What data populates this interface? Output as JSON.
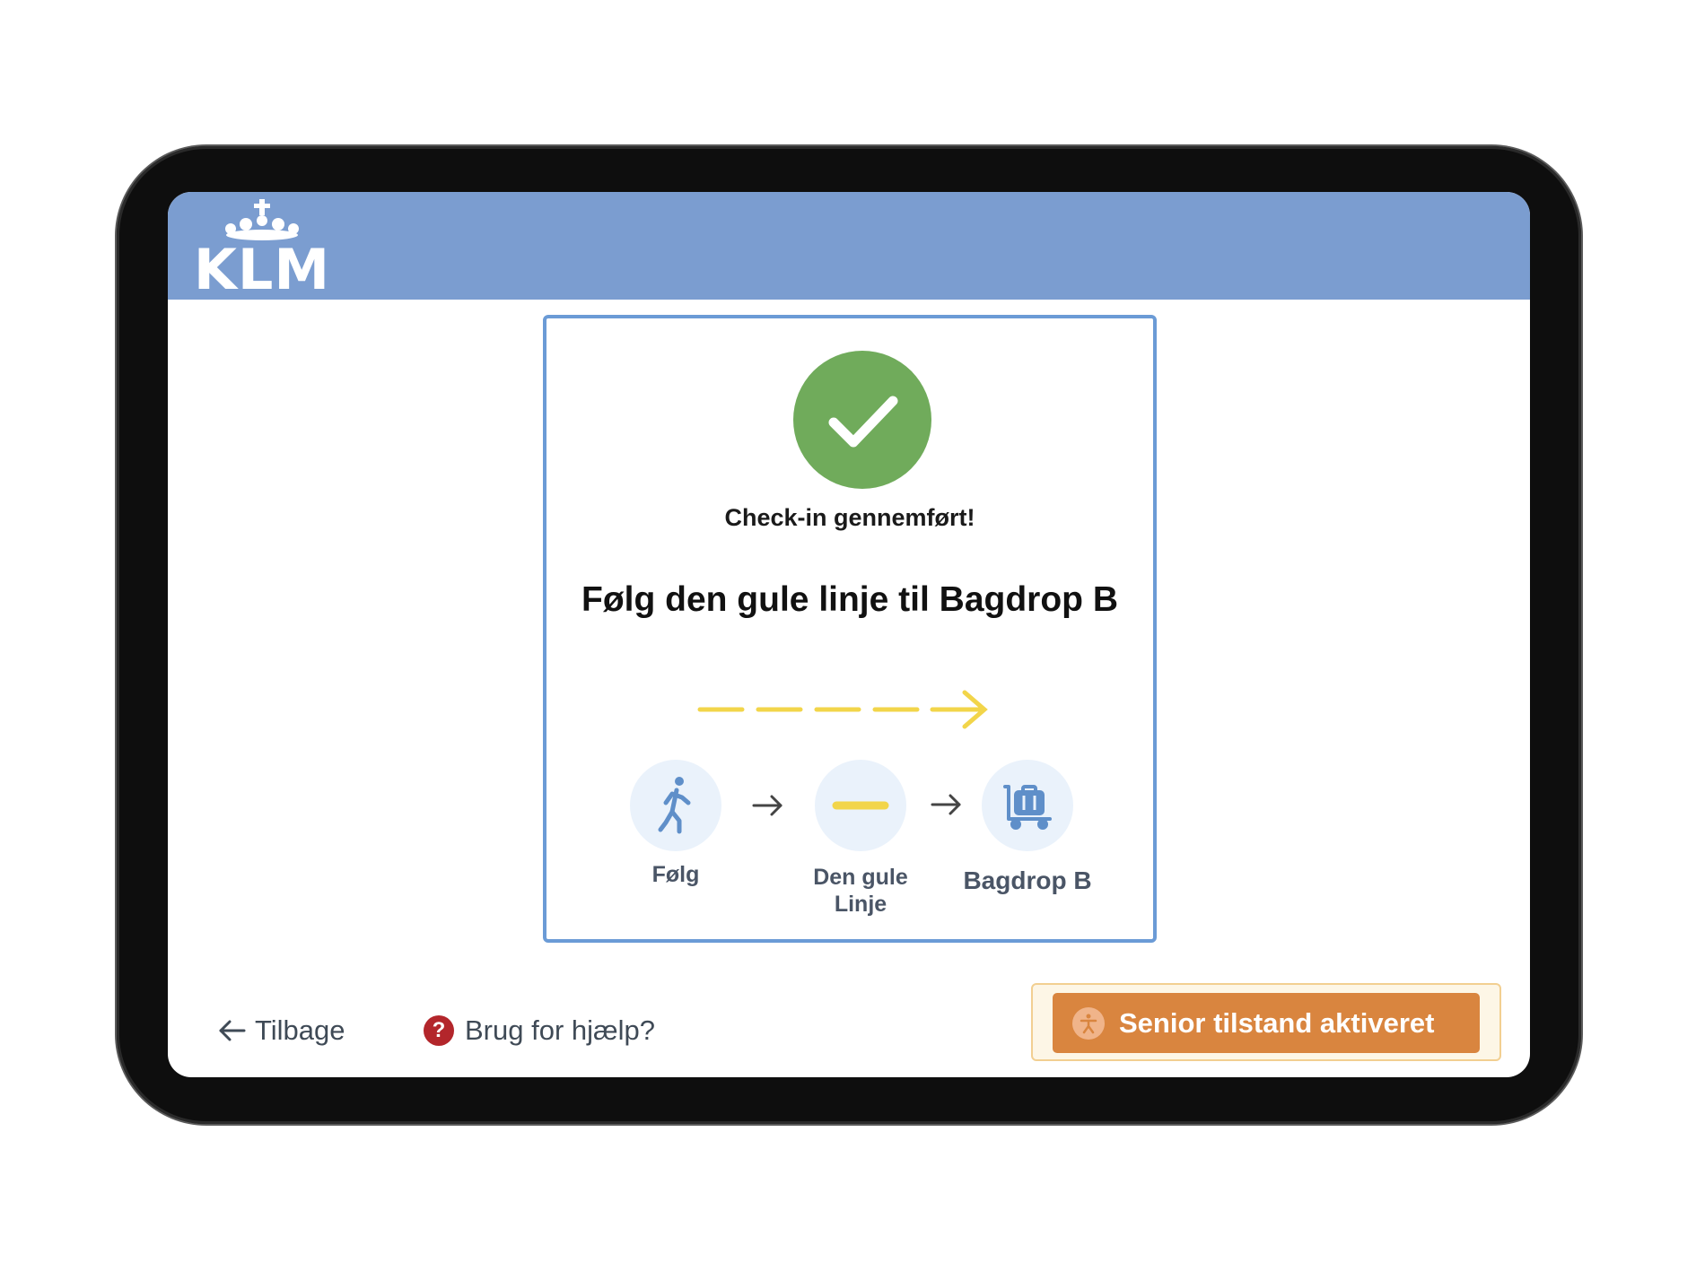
{
  "brand": {
    "logo_text": "KLM",
    "header_color": "#7b9dd0"
  },
  "status": {
    "title": "Check-in gennemført!",
    "icon": "check-icon",
    "color": "#70ab5b"
  },
  "instruction": {
    "title": "Følg den gule linje til Bagdrop B",
    "line_color": "#f2d54a"
  },
  "steps": [
    {
      "icon": "walking-person-icon",
      "label": "Følg"
    },
    {
      "icon": "yellow-line-icon",
      "label": "Den gule Linje"
    },
    {
      "icon": "luggage-cart-icon",
      "label": "Bagdrop B"
    }
  ],
  "footer": {
    "back_label": "Tilbage",
    "help_label": "Brug for hjælp?",
    "senior_label": "Senior tilstand aktiveret",
    "accent_color": "#d9853f"
  }
}
